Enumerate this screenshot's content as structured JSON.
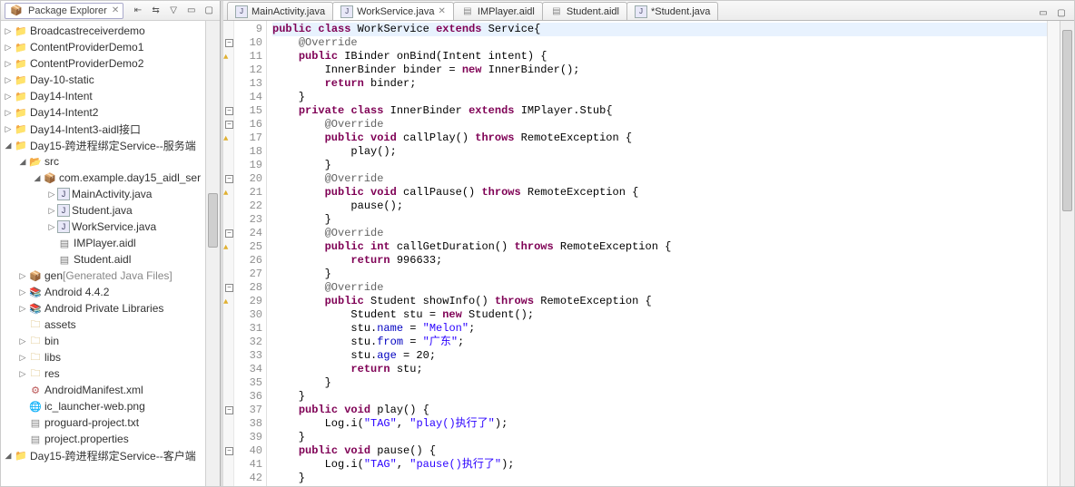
{
  "packageExplorer": {
    "title": "Package Explorer",
    "tree": [
      {
        "depth": 0,
        "twisty": "▷",
        "icon": "proj",
        "label": "Broadcastreceiverdemo"
      },
      {
        "depth": 0,
        "twisty": "▷",
        "icon": "proj",
        "label": "ContentProviderDemo1"
      },
      {
        "depth": 0,
        "twisty": "▷",
        "icon": "proj",
        "label": "ContentProviderDemo2"
      },
      {
        "depth": 0,
        "twisty": "▷",
        "icon": "proj",
        "label": "Day-10-static"
      },
      {
        "depth": 0,
        "twisty": "▷",
        "icon": "proj",
        "label": "Day14-Intent"
      },
      {
        "depth": 0,
        "twisty": "▷",
        "icon": "proj",
        "label": "Day14-Intent2"
      },
      {
        "depth": 0,
        "twisty": "▷",
        "icon": "proj",
        "label": "Day14-Intent3-aidl接口"
      },
      {
        "depth": 0,
        "twisty": "◢",
        "icon": "proj",
        "label": "Day15-跨进程绑定Service--服务端"
      },
      {
        "depth": 1,
        "twisty": "◢",
        "icon": "src",
        "label": "src"
      },
      {
        "depth": 2,
        "twisty": "◢",
        "icon": "pkgsrc",
        "label": "com.example.day15_aidl_ser"
      },
      {
        "depth": 3,
        "twisty": "▷",
        "icon": "java",
        "label": "MainActivity.java"
      },
      {
        "depth": 3,
        "twisty": "▷",
        "icon": "java",
        "label": "Student.java"
      },
      {
        "depth": 3,
        "twisty": "▷",
        "icon": "java",
        "label": "WorkService.java"
      },
      {
        "depth": 3,
        "twisty": "",
        "icon": "file",
        "label": "IMPlayer.aidl"
      },
      {
        "depth": 3,
        "twisty": "",
        "icon": "file",
        "label": "Student.aidl"
      },
      {
        "depth": 1,
        "twisty": "▷",
        "icon": "pkgsrc",
        "label": "gen",
        "extra": "[Generated Java Files]"
      },
      {
        "depth": 1,
        "twisty": "▷",
        "icon": "lib",
        "label": "Android 4.4.2"
      },
      {
        "depth": 1,
        "twisty": "▷",
        "icon": "lib",
        "label": "Android Private Libraries"
      },
      {
        "depth": 1,
        "twisty": "",
        "icon": "folder",
        "label": "assets"
      },
      {
        "depth": 1,
        "twisty": "▷",
        "icon": "folder",
        "label": "bin"
      },
      {
        "depth": 1,
        "twisty": "▷",
        "icon": "folder",
        "label": "libs"
      },
      {
        "depth": 1,
        "twisty": "▷",
        "icon": "folder",
        "label": "res"
      },
      {
        "depth": 1,
        "twisty": "",
        "icon": "xml",
        "label": "AndroidManifest.xml"
      },
      {
        "depth": 1,
        "twisty": "",
        "icon": "web",
        "label": "ic_launcher-web.png"
      },
      {
        "depth": 1,
        "twisty": "",
        "icon": "txt",
        "label": "proguard-project.txt"
      },
      {
        "depth": 1,
        "twisty": "",
        "icon": "txt",
        "label": "project.properties"
      },
      {
        "depth": 0,
        "twisty": "◢",
        "icon": "proj",
        "label": "Day15-跨进程绑定Service--客户端"
      }
    ]
  },
  "editorTabs": [
    {
      "icon": "java",
      "label": "MainActivity.java",
      "active": false,
      "dirty": false
    },
    {
      "icon": "java",
      "label": "WorkService.java",
      "active": true,
      "dirty": false
    },
    {
      "icon": "aidl",
      "label": "IMPlayer.aidl",
      "active": false,
      "dirty": false
    },
    {
      "icon": "aidl",
      "label": "Student.aidl",
      "active": false,
      "dirty": false
    },
    {
      "icon": "java",
      "label": "*Student.java",
      "active": false,
      "dirty": true
    }
  ],
  "code": {
    "firstLine": 9,
    "lines": [
      {
        "n": 9,
        "fold": "",
        "warn": false,
        "html": "<span class='kw'>public</span> <span class='kw'>class</span> WorkService <span class='kw'>extends</span> Service{",
        "hl": true
      },
      {
        "n": 10,
        "fold": "⊖",
        "warn": false,
        "html": "    <span class='an'>@Override</span>"
      },
      {
        "n": 11,
        "fold": "",
        "warn": true,
        "html": "    <span class='kw'>public</span> IBinder onBind(Intent intent) {"
      },
      {
        "n": 12,
        "fold": "",
        "warn": false,
        "html": "        InnerBinder binder = <span class='kw'>new</span> InnerBinder();"
      },
      {
        "n": 13,
        "fold": "",
        "warn": false,
        "html": "        <span class='kw'>return</span> binder;"
      },
      {
        "n": 14,
        "fold": "",
        "warn": false,
        "html": "    }"
      },
      {
        "n": 15,
        "fold": "⊖",
        "warn": false,
        "html": "    <span class='kw'>private</span> <span class='kw'>class</span> InnerBinder <span class='kw'>extends</span> IMPlayer.Stub{"
      },
      {
        "n": 16,
        "fold": "⊖",
        "warn": false,
        "html": "        <span class='an'>@Override</span>"
      },
      {
        "n": 17,
        "fold": "",
        "warn": true,
        "html": "        <span class='kw'>public</span> <span class='kw'>void</span> callPlay() <span class='kw'>throws</span> RemoteException {"
      },
      {
        "n": 18,
        "fold": "",
        "warn": false,
        "html": "            play();"
      },
      {
        "n": 19,
        "fold": "",
        "warn": false,
        "html": "        }"
      },
      {
        "n": 20,
        "fold": "⊖",
        "warn": false,
        "html": "        <span class='an'>@Override</span>"
      },
      {
        "n": 21,
        "fold": "",
        "warn": true,
        "html": "        <span class='kw'>public</span> <span class='kw'>void</span> callPause() <span class='kw'>throws</span> RemoteException {"
      },
      {
        "n": 22,
        "fold": "",
        "warn": false,
        "html": "            pause();"
      },
      {
        "n": 23,
        "fold": "",
        "warn": false,
        "html": "        }"
      },
      {
        "n": 24,
        "fold": "⊖",
        "warn": false,
        "html": "        <span class='an'>@Override</span>"
      },
      {
        "n": 25,
        "fold": "",
        "warn": true,
        "html": "        <span class='kw'>public</span> <span class='kw'>int</span> callGetDuration() <span class='kw'>throws</span> RemoteException {"
      },
      {
        "n": 26,
        "fold": "",
        "warn": false,
        "html": "            <span class='kw'>return</span> 996633;"
      },
      {
        "n": 27,
        "fold": "",
        "warn": false,
        "html": "        }"
      },
      {
        "n": 28,
        "fold": "⊖",
        "warn": false,
        "html": "        <span class='an'>@Override</span>"
      },
      {
        "n": 29,
        "fold": "",
        "warn": true,
        "html": "        <span class='kw'>public</span> Student showInfo() <span class='kw'>throws</span> RemoteException {"
      },
      {
        "n": 30,
        "fold": "",
        "warn": false,
        "html": "            Student stu = <span class='kw'>new</span> Student();"
      },
      {
        "n": 31,
        "fold": "",
        "warn": false,
        "html": "            stu.<span class='fld'>name</span> = <span class='str'>\"Melon\"</span>;"
      },
      {
        "n": 32,
        "fold": "",
        "warn": false,
        "html": "            stu.<span class='fld'>from</span> = <span class='str'>\"广东\"</span>;"
      },
      {
        "n": 33,
        "fold": "",
        "warn": false,
        "html": "            stu.<span class='fld'>age</span> = 20;"
      },
      {
        "n": 34,
        "fold": "",
        "warn": false,
        "html": "            <span class='kw'>return</span> stu;"
      },
      {
        "n": 35,
        "fold": "",
        "warn": false,
        "html": "        }"
      },
      {
        "n": 36,
        "fold": "",
        "warn": false,
        "html": "    }"
      },
      {
        "n": 37,
        "fold": "⊖",
        "warn": false,
        "html": "    <span class='kw'>public</span> <span class='kw'>void</span> play() {"
      },
      {
        "n": 38,
        "fold": "",
        "warn": false,
        "html": "        Log.<span class='id'>i</span>(<span class='str'>\"TAG\"</span>, <span class='str'>\"play()执行了\"</span>);"
      },
      {
        "n": 39,
        "fold": "",
        "warn": false,
        "html": "    }"
      },
      {
        "n": 40,
        "fold": "⊖",
        "warn": false,
        "html": "    <span class='kw'>public</span> <span class='kw'>void</span> pause() {"
      },
      {
        "n": 41,
        "fold": "",
        "warn": false,
        "html": "        Log.<span class='id'>i</span>(<span class='str'>\"TAG\"</span>, <span class='str'>\"pause()执行了\"</span>);"
      },
      {
        "n": 42,
        "fold": "",
        "warn": false,
        "html": "    }"
      }
    ]
  }
}
